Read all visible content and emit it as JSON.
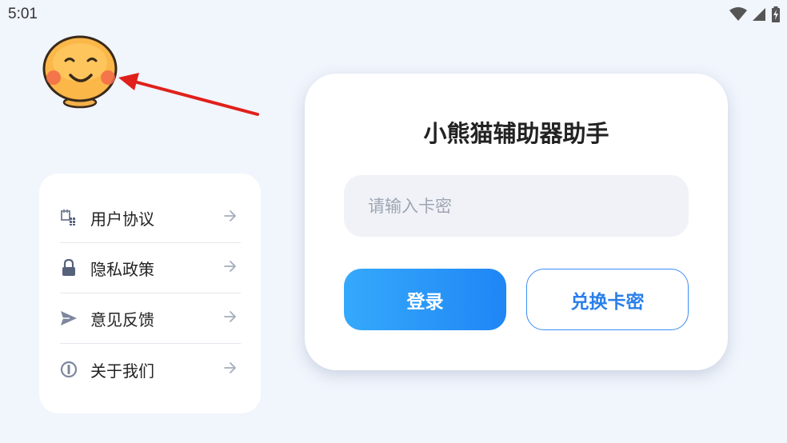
{
  "status_bar": {
    "time": "5:01",
    "icons": [
      "wifi-icon",
      "cell-signal-icon",
      "battery-charging-icon"
    ]
  },
  "mascot": {
    "icon": "smiling-face-avatar-icon"
  },
  "menu": {
    "items": [
      {
        "label": "用户协议",
        "icon": "document-grid-icon"
      },
      {
        "label": "隐私政策",
        "icon": "lock-icon"
      },
      {
        "label": "意见反馈",
        "icon": "send-icon"
      },
      {
        "label": "关于我们",
        "icon": "info-circle-icon"
      }
    ],
    "arrow_icon": "arrow-right-icon"
  },
  "login": {
    "title": "小熊猫辅助器助手",
    "input_placeholder": "请输入卡密",
    "input_value": "",
    "login_label": "登录",
    "redeem_label": "兑换卡密"
  },
  "colors": {
    "background": "#f1f5fc",
    "accent": "#1f86f5",
    "annotation_arrow": "#e0201b"
  }
}
